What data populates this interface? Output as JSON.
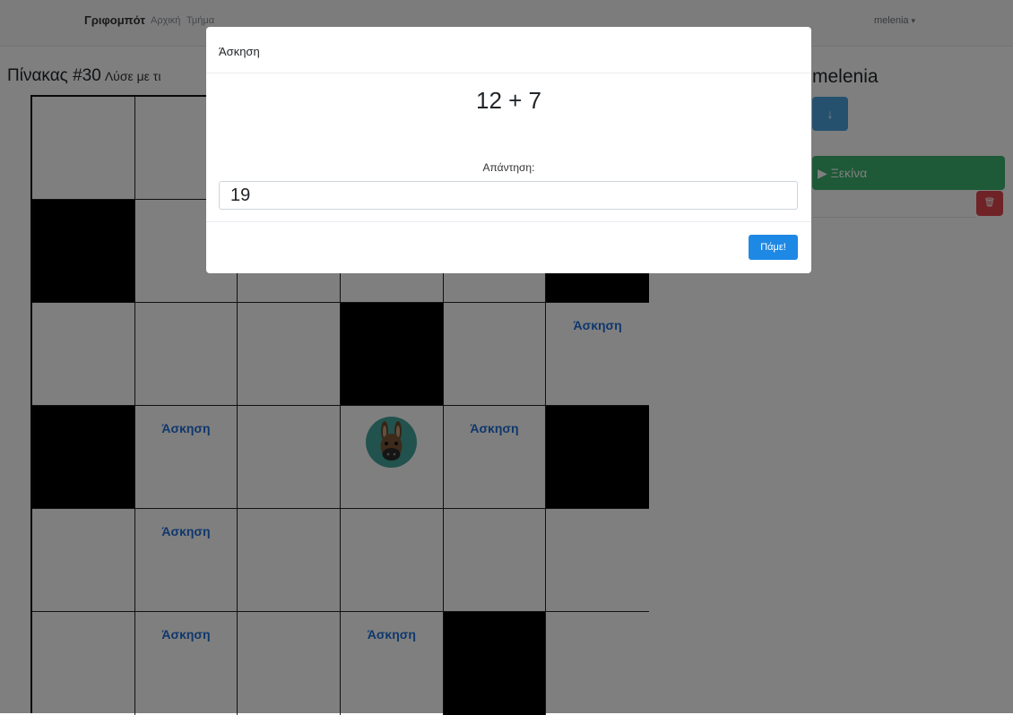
{
  "navbar": {
    "brand": "Γριφομπότ",
    "links": [
      "Αρχική",
      "Τμήμα"
    ],
    "user": "melenia",
    "user_caret": "▾"
  },
  "board": {
    "title": "Πίνακας #30",
    "subtitle": "Λύσε με τι",
    "task_label": "Άσκηση",
    "rows": [
      [
        "white",
        "white",
        "white",
        "white",
        "white",
        "white"
      ],
      [
        "black",
        "white",
        "white",
        "white",
        "white",
        "black"
      ],
      [
        "white",
        "white",
        "white",
        "black",
        "white",
        "task"
      ],
      [
        "black",
        "task",
        "white",
        "avatar",
        "task",
        "black"
      ],
      [
        "white",
        "task",
        "white",
        "white",
        "white",
        "white"
      ],
      [
        "white",
        "task",
        "white",
        "task",
        "black",
        "white"
      ]
    ]
  },
  "sidebar": {
    "player_name": "melenia",
    "down_icon": "arrow-down-icon",
    "down_glyph": "↓",
    "start_label": "▶ Ξεκίνα",
    "delete_icon": "trash-icon",
    "delete_glyph": "🗑"
  },
  "modal": {
    "title": "Άσκηση",
    "question": "12 + 7",
    "answer_label": "Απάντηση:",
    "answer_value": "19",
    "submit_label": "Πάμε!"
  },
  "colors": {
    "task_blue": "#1e6fd9",
    "start_green": "#3cb371",
    "down_blue": "#4aa3df",
    "delete_red": "#e0474c",
    "submit_blue": "#1e88e5",
    "avatar_teal": "#45a59a"
  }
}
